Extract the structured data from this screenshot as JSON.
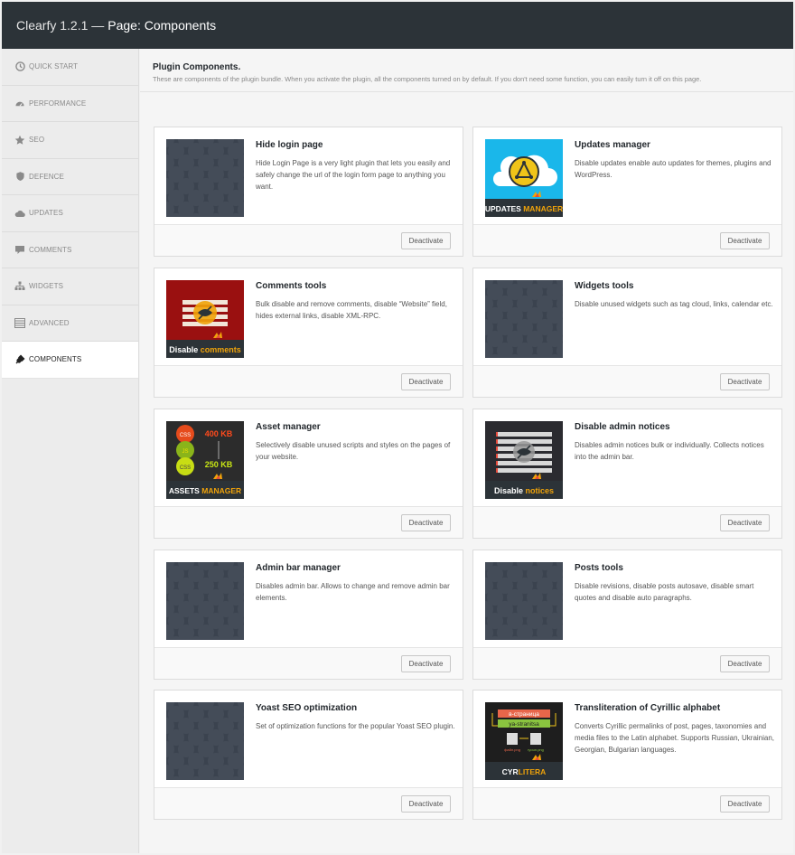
{
  "header": {
    "app_version": "Clearfy 1.2.1 —",
    "page_title": "Page: Components"
  },
  "sidebar": {
    "items": [
      {
        "label": "QUICK START",
        "icon": "clock-icon"
      },
      {
        "label": "PERFORMANCE",
        "icon": "dashboard-icon"
      },
      {
        "label": "SEO",
        "icon": "star-icon"
      },
      {
        "label": "DEFENCE",
        "icon": "shield-icon"
      },
      {
        "label": "UPDATES",
        "icon": "cloud-icon"
      },
      {
        "label": "COMMENTS",
        "icon": "comment-icon"
      },
      {
        "label": "WIDGETS",
        "icon": "sitemap-icon"
      },
      {
        "label": "ADVANCED",
        "icon": "list-icon"
      },
      {
        "label": "COMPONENTS",
        "icon": "plug-icon",
        "active": true
      }
    ]
  },
  "main": {
    "heading": "Plugin Components.",
    "subheading": "These are components of the plugin bundle. When you activate the plugin, all the components turned on by default. If you don't need some function, you can easily turn it off on this page.",
    "button_label": "Deactivate",
    "components": [
      {
        "title": "Hide login page",
        "description": "Hide Login Page is a very light plugin that lets you easily and safely change the url of the login form page to anything you want.",
        "thumb": "placeholder"
      },
      {
        "title": "Updates manager",
        "description": "Disable updates enable auto updates for themes, plugins and WordPress.",
        "thumb": "updates",
        "thumb_label_a": "UPDATES",
        "thumb_label_b": "MANAGER"
      },
      {
        "title": "Comments tools",
        "description": "Bulk disable and remove comments, disable “Website” field, hides external links, disable XML-RPC.",
        "thumb": "comments",
        "thumb_label_a": "Disable",
        "thumb_label_b": "comments"
      },
      {
        "title": "Widgets tools",
        "description": "Disable unused widgets such as tag cloud, links, calendar etc.",
        "thumb": "placeholder"
      },
      {
        "title": "Asset manager",
        "description": "Selectively disable unused scripts and styles on the pages of your website.",
        "thumb": "assets",
        "thumb_label_a": "ASSETS",
        "thumb_label_b": "MANAGER",
        "size_a": "400 KB",
        "size_b": "250 KB"
      },
      {
        "title": "Disable admin notices",
        "description": "Disables admin notices bulk or individually. Collects notices into the admin bar.",
        "thumb": "notices",
        "thumb_label_a": "Disable",
        "thumb_label_b": "notices"
      },
      {
        "title": "Admin bar manager",
        "description": "Disables admin bar. Allows to change and remove admin bar elements.",
        "thumb": "placeholder"
      },
      {
        "title": "Posts tools",
        "description": "Disable revisions, disable posts autosave, disable smart quotes and disable auto paragraphs.",
        "thumb": "placeholder"
      },
      {
        "title": "Yoast SEO optimization",
        "description": "Set of optimization functions for the popular Yoast SEO plugin.",
        "thumb": "placeholder"
      },
      {
        "title": "Transliteration of Cyrillic alphabet",
        "description": "Converts Cyrillic permalinks of post, pages, taxonomies and media files to the Latin alphabet. Supports Russian, Ukrainian, Georgian, Bulgarian languages.",
        "thumb": "cyrlitera",
        "thumb_label_a": "CYR",
        "thumb_label_b": "LITERA",
        "cyr_word": "в-страница",
        "lat_word": "ya-stranitsa",
        "file_a": "файл.png",
        "file_b": "ryoun.png"
      }
    ]
  },
  "colors": {
    "topbar": "#2c3338",
    "orange": "#f0a30a",
    "updates_bg": "#1ab7ea",
    "comments_bg": "#9a1010"
  },
  "brand_mark": "Webcraftic"
}
